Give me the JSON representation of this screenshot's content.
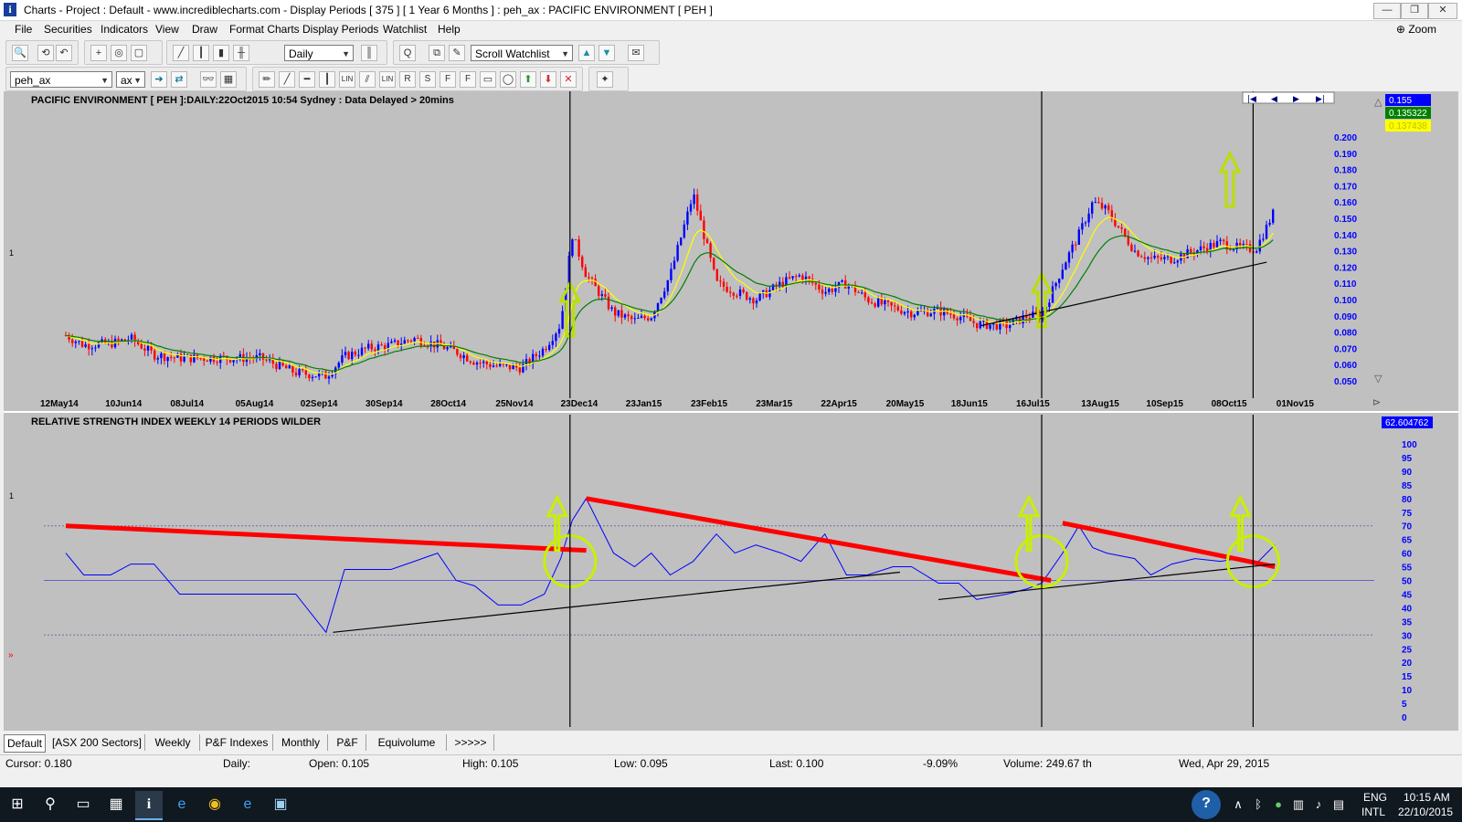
{
  "window": {
    "title": "Charts - Project : Default - www.incrediblecharts.com - Display Periods  [ 375 ]  [ 1 Year 6 Months ] : peh_ax : PACIFIC ENVIRONMENT  [ PEH ]",
    "app_icon_letter": "i",
    "minimize": "—",
    "restore": "❐",
    "close": "✕"
  },
  "menu": {
    "items": [
      "File",
      "Securities",
      "Indicators",
      "View",
      "Draw",
      "Format Charts",
      "Display Periods",
      "Watchlist",
      "Help"
    ],
    "zoom_label": "Zoom"
  },
  "toolbar1": {
    "period_value": "Daily",
    "watchlist_value": "Scroll Watchlist"
  },
  "toolbar2": {
    "security_value": "peh_ax",
    "exchange_value": "ax",
    "draw_buttons": [
      "LIN",
      "LIN",
      "R",
      "S",
      "F",
      "F"
    ]
  },
  "price_panel": {
    "header": "PACIFIC ENVIRONMENT [ PEH ]:DAILY:22Oct2015 10:54 Sydney : Data Delayed > 20mins",
    "left_marker": "1",
    "price_labels": [
      "0.155",
      "0.135322",
      "0.137438"
    ],
    "price_label_colors": [
      "#0000ff",
      "#008000",
      "#ffff00"
    ],
    "nav_buttons": [
      "|◀",
      "◀",
      "▶",
      "▶|"
    ]
  },
  "rsi_panel": {
    "header": "RELATIVE STRENGTH INDEX WEEKLY 14 PERIODS WILDER",
    "left_marker": "1",
    "left_marker_2": "»",
    "value_label": "62.604762"
  },
  "chart_data": [
    {
      "type": "candlestick",
      "title": "PACIFIC ENVIRONMENT [ PEH ]:DAILY:22Oct2015 10:54 Sydney : Data Delayed > 20mins",
      "x_tick_labels": [
        "12May14",
        "10Jun14",
        "08Jul14",
        "05Aug14",
        "02Sep14",
        "30Sep14",
        "28Oct14",
        "25Nov14",
        "23Dec14",
        "23Jan15",
        "23Feb15",
        "23Mar15",
        "22Apr15",
        "20May15",
        "18Jun15",
        "16Jul15",
        "13Aug15",
        "10Sep15",
        "08Oct15",
        "01Nov15"
      ],
      "y_tick_labels": [
        "0.200",
        "0.190",
        "0.180",
        "0.170",
        "0.160",
        "0.150",
        "0.140",
        "0.130",
        "0.120",
        "0.110",
        "0.100",
        "0.090",
        "0.080",
        "0.070",
        "0.060",
        "0.050"
      ],
      "ylim": [
        0.045,
        0.205
      ],
      "grid": false,
      "series": [
        {
          "name": "close",
          "color": "#0000ff",
          "x": [
            "12May14",
            "20May14",
            "01Jun14",
            "10Jun14",
            "20Jun14",
            "01Jul14",
            "08Jul14",
            "20Jul14",
            "05Aug14",
            "20Aug14",
            "02Sep14",
            "10Sep14",
            "20Sep14",
            "30Sep14",
            "10Oct14",
            "20Oct14",
            "28Oct14",
            "05Nov14",
            "15Nov14",
            "25Nov14",
            "05Dec14",
            "12Dec14",
            "17Dec14",
            "23Dec14",
            "05Jan15",
            "15Jan15",
            "23Jan15",
            "01Feb15",
            "12Feb15",
            "23Feb15",
            "03Mar15",
            "12Mar15",
            "23Mar15",
            "01Apr15",
            "12Apr15",
            "22Apr15",
            "01May15",
            "12May15",
            "20May15",
            "01Jun15",
            "10Jun15",
            "18Jun15",
            "01Jul15",
            "10Jul15",
            "16Jul15",
            "25Jul15",
            "01Aug15",
            "07Aug15",
            "13Aug15",
            "25Aug15",
            "01Sep15",
            "10Sep15",
            "20Sep15",
            "01Oct15",
            "08Oct15",
            "15Oct15",
            "22Oct15"
          ],
          "y": [
            0.078,
            0.072,
            0.073,
            0.076,
            0.066,
            0.064,
            0.064,
            0.064,
            0.064,
            0.055,
            0.053,
            0.065,
            0.07,
            0.072,
            0.076,
            0.072,
            0.068,
            0.062,
            0.059,
            0.058,
            0.07,
            0.085,
            0.14,
            0.115,
            0.092,
            0.087,
            0.09,
            0.115,
            0.165,
            0.11,
            0.105,
            0.1,
            0.11,
            0.115,
            0.105,
            0.11,
            0.1,
            0.095,
            0.092,
            0.093,
            0.09,
            0.085,
            0.084,
            0.09,
            0.09,
            0.12,
            0.14,
            0.16,
            0.155,
            0.13,
            0.125,
            0.125,
            0.13,
            0.135,
            0.132,
            0.131,
            0.155
          ]
        },
        {
          "name": "EMA fast",
          "color": "#ffff00"
        },
        {
          "name": "EMA slow",
          "color": "#008000"
        }
      ],
      "annotations": {
        "vertical_lines_at": [
          "16Dec14",
          "16Jul15",
          "14Oct15"
        ],
        "up_arrows_at": [
          "16Dec14",
          "16Jul15",
          "05Oct15"
        ],
        "support_trendline": {
          "from": [
            "20Jun15",
            0.084
          ],
          "to": [
            "19Oct15",
            0.123
          ],
          "color": "#000000"
        }
      }
    },
    {
      "type": "line",
      "title": "RELATIVE STRENGTH INDEX WEEKLY 14 PERIODS WILDER",
      "y_tick_labels": [
        "100",
        "95",
        "90",
        "85",
        "80",
        "75",
        "70",
        "65",
        "60",
        "55",
        "50",
        "45",
        "40",
        "35",
        "30",
        "25",
        "20",
        "15",
        "10",
        "5",
        "0"
      ],
      "ylim": [
        0,
        100
      ],
      "reference_lines": [
        70,
        50,
        30
      ],
      "series": [
        {
          "name": "RSI",
          "color": "#0000ff",
          "x": [
            "12May14",
            "20May14",
            "01Jun14",
            "10Jun14",
            "20Jun14",
            "01Jul14",
            "08Jul14",
            "20Jul14",
            "05Aug14",
            "20Aug14",
            "02Sep14",
            "10Sep14",
            "20Sep14",
            "30Sep14",
            "10Oct14",
            "20Oct14",
            "28Oct14",
            "05Nov14",
            "15Nov14",
            "25Nov14",
            "05Dec14",
            "12Dec14",
            "17Dec14",
            "23Dec14",
            "05Jan15",
            "15Jan15",
            "23Jan15",
            "01Feb15",
            "12Feb15",
            "23Feb15",
            "03Mar15",
            "12Mar15",
            "23Mar15",
            "01Apr15",
            "12Apr15",
            "22Apr15",
            "01May15",
            "12May15",
            "20May15",
            "01Jun15",
            "10Jun15",
            "18Jun15",
            "01Jul15",
            "10Jul15",
            "16Jul15",
            "25Jul15",
            "01Aug15",
            "07Aug15",
            "13Aug15",
            "25Aug15",
            "01Sep15",
            "10Sep15",
            "20Sep15",
            "01Oct15",
            "08Oct15",
            "15Oct15",
            "22Oct15"
          ],
          "y": [
            60,
            52,
            52,
            56,
            56,
            45,
            45,
            45,
            45,
            45,
            31,
            54,
            54,
            54,
            57,
            60,
            50,
            48,
            41,
            41,
            45,
            58,
            72,
            80,
            60,
            55,
            60,
            52,
            57,
            67,
            60,
            63,
            60,
            57,
            67,
            52,
            52,
            55,
            55,
            49,
            49,
            43,
            45,
            47,
            49,
            60,
            70,
            62,
            60,
            58,
            52,
            56,
            58,
            57,
            58,
            56,
            63
          ]
        }
      ],
      "annotations": {
        "resistance_lines": [
          {
            "from": [
              "12May14",
              70
            ],
            "to": [
              "23Dec14",
              61
            ],
            "color": "#ff0000"
          },
          {
            "from": [
              "23Dec14",
              80
            ],
            "to": [
              "20Jul15",
              50
            ],
            "color": "#ff0000"
          },
          {
            "from": [
              "25Jul15",
              71
            ],
            "to": [
              "22Oct15",
              55
            ],
            "color": "#ff0000"
          }
        ],
        "support_lines": [
          {
            "from": [
              "05Sep14",
              31
            ],
            "to": [
              "15May15",
              53
            ],
            "color": "#000000"
          },
          {
            "from": [
              "01Jun15",
              43
            ],
            "to": [
              "22Oct15",
              56
            ],
            "color": "#000000"
          }
        ],
        "highlight_circles_at": [
          "16Dec14",
          "16Jul15",
          "14Oct15"
        ]
      }
    }
  ],
  "tabs": [
    "Default",
    "[ASX 200 Sectors]",
    "Weekly",
    "P&F Indexes",
    "Monthly",
    "P&F",
    "Equivolume",
    ">>>>>"
  ],
  "status": {
    "cursor": "Cursor: 0.180",
    "period": "Daily:",
    "open": "Open: 0.105",
    "high": "High: 0.105",
    "low": "Low: 0.095",
    "last": "Last: 0.100",
    "change": "-9.09%",
    "volume": "Volume: 249.67 th",
    "date": "Wed, Apr 29, 2015"
  },
  "taskbar": {
    "lang_top": "ENG",
    "lang_bottom": "INTL",
    "time": "10:15 AM",
    "date": "22/10/2015"
  }
}
